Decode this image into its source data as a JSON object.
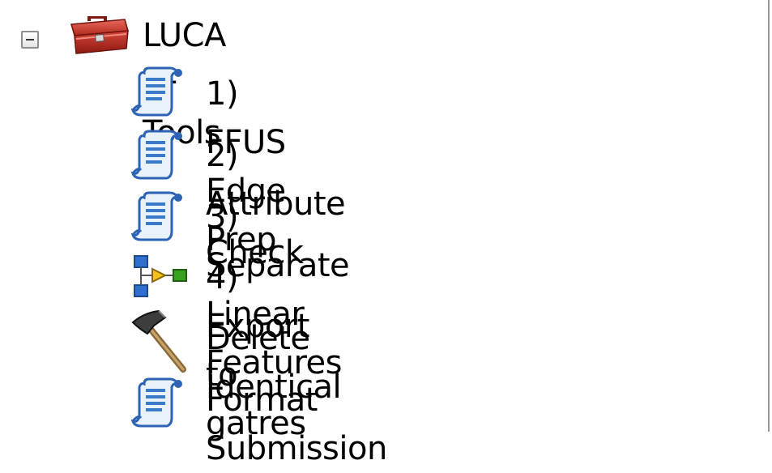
{
  "toolbox": {
    "name": "LUCA LF Tools",
    "icon": "toolbox-icon",
    "expanded": true
  },
  "tools": [
    {
      "label": "1) FFUS Edge Prep",
      "icon": "script-icon"
    },
    {
      "label": "2) Attribute Check",
      "icon": "script-icon"
    },
    {
      "label": "3) Separate Linear Features",
      "icon": "script-icon"
    },
    {
      "label": "4) Export to gatres",
      "icon": "model-icon"
    },
    {
      "label": "Delete Identical",
      "icon": "hammer-icon"
    },
    {
      "label": "Format Submission",
      "icon": "script-icon"
    }
  ],
  "colors": {
    "toolbox_red": "#c0392b",
    "script_blue": "#3a78c8",
    "model_blue": "#2f6fd0",
    "model_green": "#39a020",
    "expander_border": "#8e8f8f",
    "panel_border": "#9a9a9a"
  }
}
